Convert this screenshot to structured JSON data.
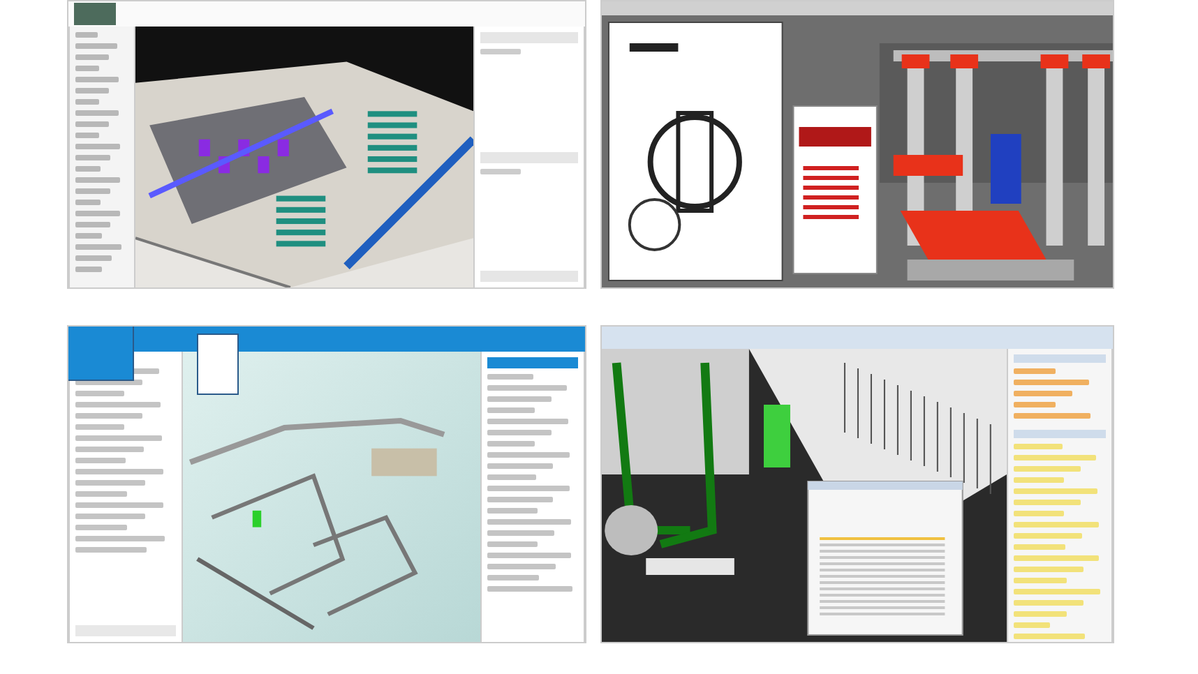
{
  "panels": [
    {
      "kind": "desktop-viewer"
    },
    {
      "kind": "document-viewer"
    },
    {
      "kind": "web-portal"
    },
    {
      "kind": "properties-viewer"
    }
  ]
}
